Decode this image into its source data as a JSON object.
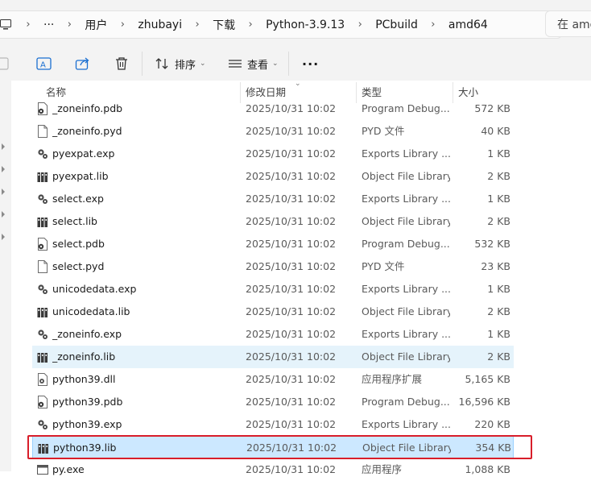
{
  "breadcrumb": {
    "more": "···",
    "items": [
      "用户",
      "zhubayi",
      "下载",
      "Python-3.9.13",
      "PCbuild",
      "amd64"
    ]
  },
  "search": {
    "placeholder": "在 amd"
  },
  "toolbar": {
    "sort_label": "排序",
    "view_label": "查看",
    "more_label": "···"
  },
  "columns": {
    "name": "名称",
    "date": "修改日期",
    "type": "类型",
    "size": "大小"
  },
  "files": [
    {
      "name": "_zoneinfo.pdb",
      "date": "2025/10/31 10:02",
      "type": "Program Debug...",
      "size": "572 KB",
      "icon": "pdb"
    },
    {
      "name": "_zoneinfo.pyd",
      "date": "2025/10/31 10:02",
      "type": "PYD 文件",
      "size": "40 KB",
      "icon": "file"
    },
    {
      "name": "pyexpat.exp",
      "date": "2025/10/31 10:02",
      "type": "Exports Library ...",
      "size": "1 KB",
      "icon": "exp"
    },
    {
      "name": "pyexpat.lib",
      "date": "2025/10/31 10:02",
      "type": "Object File Library",
      "size": "2 KB",
      "icon": "lib"
    },
    {
      "name": "select.exp",
      "date": "2025/10/31 10:02",
      "type": "Exports Library ...",
      "size": "1 KB",
      "icon": "exp"
    },
    {
      "name": "select.lib",
      "date": "2025/10/31 10:02",
      "type": "Object File Library",
      "size": "2 KB",
      "icon": "lib"
    },
    {
      "name": "select.pdb",
      "date": "2025/10/31 10:02",
      "type": "Program Debug...",
      "size": "532 KB",
      "icon": "pdb"
    },
    {
      "name": "select.pyd",
      "date": "2025/10/31 10:02",
      "type": "PYD 文件",
      "size": "23 KB",
      "icon": "file"
    },
    {
      "name": "unicodedata.exp",
      "date": "2025/10/31 10:02",
      "type": "Exports Library ...",
      "size": "1 KB",
      "icon": "exp"
    },
    {
      "name": "unicodedata.lib",
      "date": "2025/10/31 10:02",
      "type": "Object File Library",
      "size": "2 KB",
      "icon": "lib"
    },
    {
      "name": "_zoneinfo.exp",
      "date": "2025/10/31 10:02",
      "type": "Exports Library ...",
      "size": "1 KB",
      "icon": "exp"
    },
    {
      "name": "_zoneinfo.lib",
      "date": "2025/10/31 10:02",
      "type": "Object File Library",
      "size": "2 KB",
      "icon": "lib",
      "state": "light"
    },
    {
      "name": "python39.dll",
      "date": "2025/10/31 10:02",
      "type": "应用程序扩展",
      "size": "5,165 KB",
      "icon": "dll"
    },
    {
      "name": "python39.pdb",
      "date": "2025/10/31 10:02",
      "type": "Program Debug...",
      "size": "16,596 KB",
      "icon": "pdb"
    },
    {
      "name": "python39.exp",
      "date": "2025/10/31 10:02",
      "type": "Exports Library ...",
      "size": "220 KB",
      "icon": "exp"
    },
    {
      "name": "python39.lib",
      "date": "2025/10/31 10:02",
      "type": "Object File Library",
      "size": "354 KB",
      "icon": "lib",
      "state": "selected"
    },
    {
      "name": "py.exe",
      "date": "2025/10/31 10:02",
      "type": "应用程序",
      "size": "1,088 KB",
      "icon": "exe"
    }
  ]
}
